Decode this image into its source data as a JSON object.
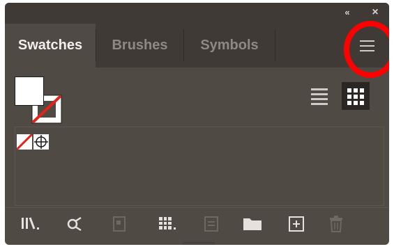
{
  "panel": {
    "collapse_glyph": "«",
    "close_glyph": "×",
    "tabs": [
      {
        "label": "Swatches",
        "active": true
      },
      {
        "label": "Brushes",
        "active": false
      },
      {
        "label": "Symbols",
        "active": false
      }
    ],
    "menu_icon": "hamburger-menu-icon",
    "highlight_color": "#ff0000"
  },
  "fill_stroke": {
    "fill": "white",
    "stroke": "none"
  },
  "view_toggle": {
    "list_view_icon": "list-view-icon",
    "thumbnail_view_icon": "thumbnail-view-icon",
    "selected": "thumbnail"
  },
  "swatches": [
    {
      "name": "none",
      "icon": "none-swatch-icon"
    },
    {
      "name": "registration",
      "icon": "registration-swatch-icon"
    }
  ],
  "bottom_toolbar": [
    {
      "icon": "swatch-libraries-icon",
      "enabled": true
    },
    {
      "icon": "show-swatch-kinds-icon",
      "enabled": true
    },
    {
      "icon": "place-swatch-icon",
      "enabled": false
    },
    {
      "icon": "swatch-options-grid-icon",
      "enabled": true
    },
    {
      "icon": "swatch-options-icon",
      "enabled": false
    },
    {
      "icon": "new-color-group-icon",
      "enabled": true
    },
    {
      "icon": "new-swatch-icon",
      "enabled": true
    },
    {
      "icon": "delete-swatch-icon",
      "enabled": false
    }
  ]
}
